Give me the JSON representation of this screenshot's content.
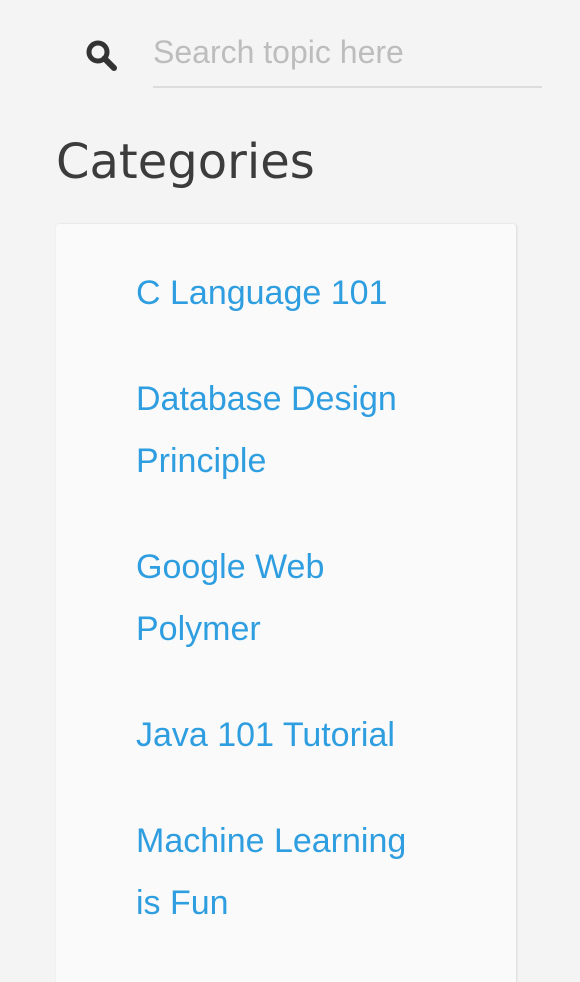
{
  "search": {
    "placeholder": "Search topic here",
    "value": "",
    "icon": "search-icon"
  },
  "categories": {
    "title": "Categories",
    "items": [
      {
        "label": "C Language 101"
      },
      {
        "label": "Database Design Principle"
      },
      {
        "label": "Google Web Polymer"
      },
      {
        "label": "Java 101 Tutorial"
      },
      {
        "label": "Machine Learning is Fun"
      }
    ]
  },
  "colors": {
    "link": "#2f9ee0",
    "title": "#3c3c3c",
    "placeholder": "#bdbdbd",
    "background": "#f4f4f4",
    "card": "#fafafa"
  }
}
